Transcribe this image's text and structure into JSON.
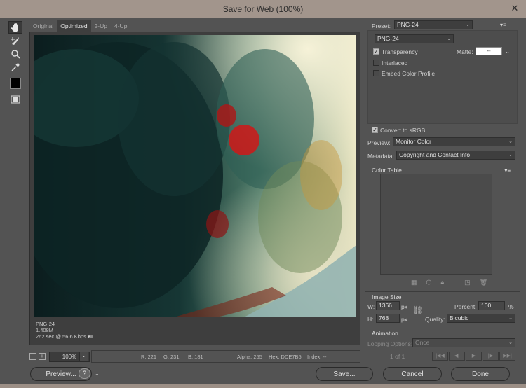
{
  "window": {
    "title": "Save for Web (100%)",
    "close": "✕"
  },
  "tools": [
    "hand-tool",
    "slice-select-tool",
    "zoom-tool",
    "eyedropper-tool"
  ],
  "tabs": [
    {
      "label": "Original"
    },
    {
      "label": "Optimized"
    },
    {
      "label": "2-Up"
    },
    {
      "label": "4-Up"
    }
  ],
  "image_info": {
    "format": "PNG-24",
    "size": "1.408M",
    "time": "262 sec @ 56.6 Kbps",
    "menu": "▾≡"
  },
  "status": {
    "zoom": "100%",
    "r": "R: 221",
    "g": "G: 231",
    "b": "B: 181",
    "alpha": "Alpha: 255",
    "hex": "Hex: DDE7B5",
    "index": "Index: --"
  },
  "buttons": {
    "preview": "Preview...",
    "help": "?",
    "save": "Save...",
    "cancel": "Cancel",
    "done": "Done"
  },
  "settings": {
    "preset_label": "Preset:",
    "preset_value": "PNG-24",
    "format_value": "PNG-24",
    "transparency": "Transparency",
    "matte_label": "Matte:",
    "matte_value": "--",
    "interlaced": "Interlaced",
    "embed": "Embed Color Profile",
    "convert": "Convert to sRGB",
    "preview_label": "Preview:",
    "preview_value": "Monitor Color",
    "metadata_label": "Metadata:",
    "metadata_value": "Copyright and Contact Info"
  },
  "color_table": {
    "title": "Color Table"
  },
  "image_size": {
    "title": "Image Size",
    "w_label": "W:",
    "w_value": "1366",
    "h_label": "H:",
    "h_value": "768",
    "unit": "px",
    "percent_label": "Percent:",
    "percent_value": "100",
    "percent_unit": "%",
    "quality_label": "Quality:",
    "quality_value": "Bicubic"
  },
  "animation": {
    "title": "Animation",
    "looping_label": "Looping Options:",
    "looping_value": "Once",
    "frame": "1 of 1"
  }
}
